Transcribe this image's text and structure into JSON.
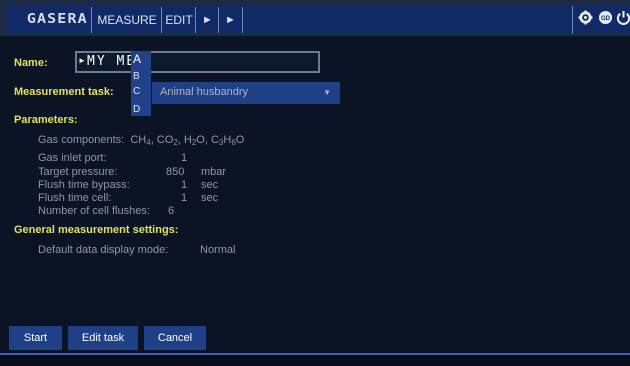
{
  "topbar": {
    "logo": "GASERA",
    "tabs": [
      "MEASURE",
      "EDIT"
    ],
    "arrow_glyph": "►",
    "icons": [
      "gear-icon",
      "gd-icon",
      "power-icon"
    ]
  },
  "form": {
    "name_label": "Name:",
    "name_value": "MY ME",
    "letter_picker": [
      "A",
      "B",
      "C",
      "D"
    ],
    "task_label": "Measurement task:",
    "task_value": "Animal husbandry",
    "parameters_label": "Parameters:",
    "gas_components_label": "Gas components:",
    "params": [
      {
        "label": "Gas inlet port:",
        "value": "1",
        "unit": ""
      },
      {
        "label": "Target pressure:",
        "value": "850",
        "unit": "mbar"
      },
      {
        "label": "Flush time bypass:",
        "value": "1",
        "unit": "sec"
      },
      {
        "label": "Flush time cell:",
        "value": "1",
        "unit": "sec"
      },
      {
        "label": "Number of cell flushes:",
        "value": "6",
        "unit": ""
      }
    ],
    "general_label": "General measurement settings:",
    "display_mode_label": "Default data display mode:",
    "display_mode_value": "Normal"
  },
  "buttons": {
    "start": "Start",
    "edit_task": "Edit task",
    "cancel": "Cancel"
  }
}
